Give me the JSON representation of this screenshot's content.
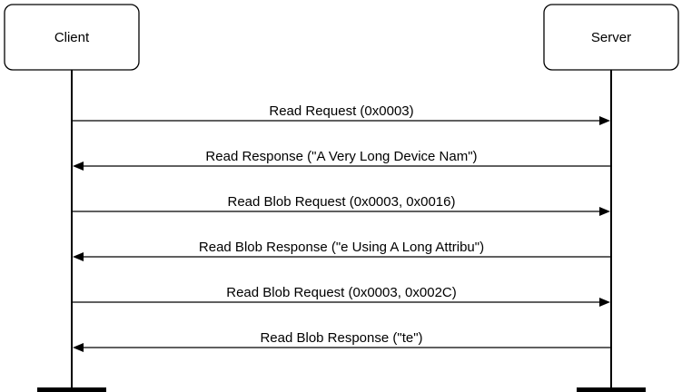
{
  "actors": {
    "client": "Client",
    "server": "Server"
  },
  "messages": [
    {
      "label": "Read Request (0x0003)",
      "direction": "to-server"
    },
    {
      "label": "Read Response (\"A Very Long Device Nam\")",
      "direction": "to-client"
    },
    {
      "label": "Read Blob Request (0x0003, 0x0016)",
      "direction": "to-server"
    },
    {
      "label": "Read Blob Response (\"e Using A Long Attribu\")",
      "direction": "to-client"
    },
    {
      "label": "Read Blob Request (0x0003, 0x002C)",
      "direction": "to-server"
    },
    {
      "label": "Read Blob Response (\"te\")",
      "direction": "to-client"
    }
  ]
}
